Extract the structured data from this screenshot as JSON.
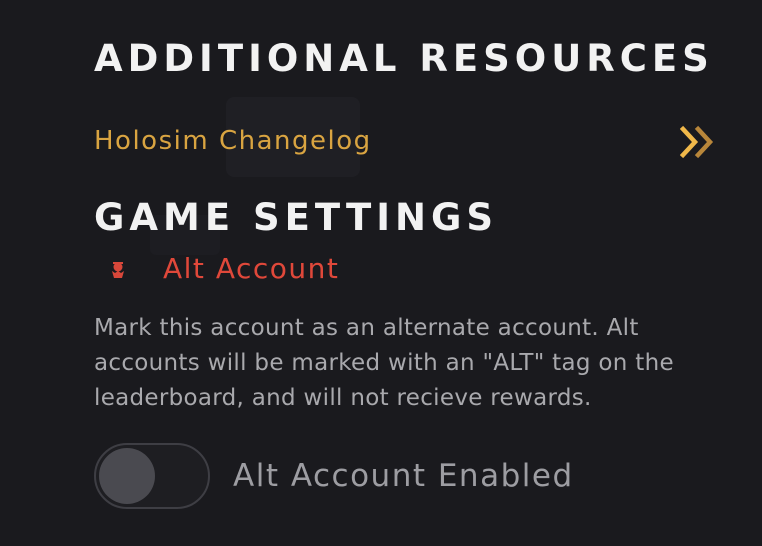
{
  "additional_resources": {
    "title": "ADDITIONAL RESOURCES",
    "link_label": "Holosim Changelog",
    "link_icon": "double-chevron-right-icon"
  },
  "game_settings": {
    "title": "GAME SETTINGS",
    "setting_icon": "alt-account-icon",
    "setting_name": "Alt Account",
    "description": "Mark this account as an alternate account. Alt accounts will be marked with an \"ALT\" tag on the leaderboard, and will not recieve rewards.",
    "toggle_label": "Alt Account Enabled",
    "toggle_on": false
  },
  "colors": {
    "background": "#1a1a1e",
    "heading": "#f2f2f2",
    "link": "#d9a441",
    "setting_name": "#e0483a",
    "description": "#a9a9ad",
    "toggle_label": "#9d9da2"
  }
}
